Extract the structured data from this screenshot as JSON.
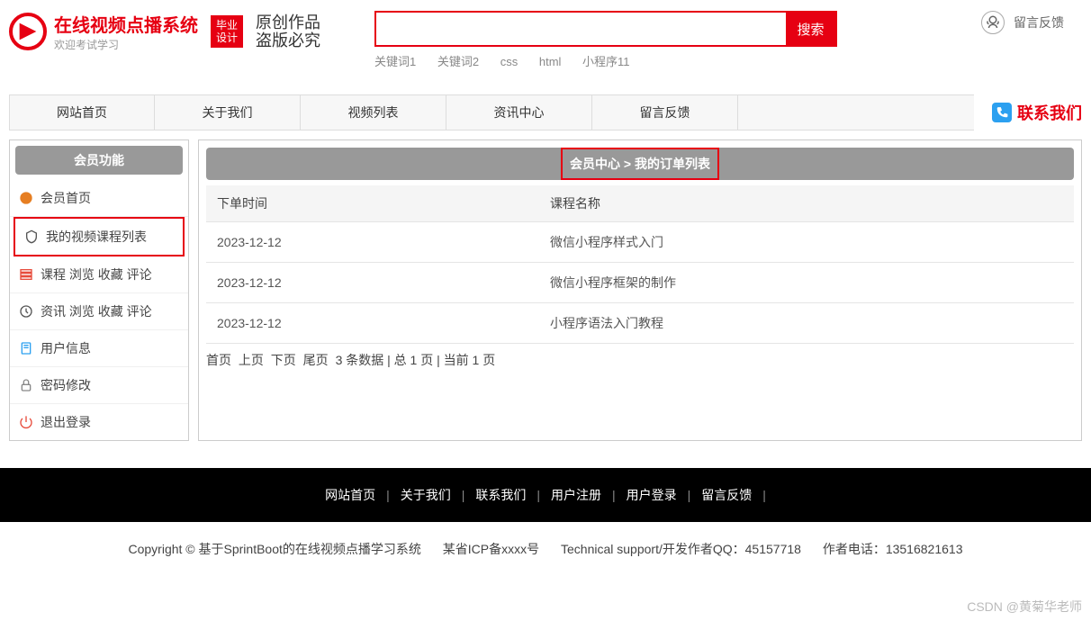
{
  "header": {
    "title": "在线视频点播系统",
    "subtitle": "欢迎考试学习",
    "badge_line1": "毕业",
    "badge_line2": "设计",
    "brush_line1": "原创作品",
    "brush_line2": "盗版必究",
    "search_btn": "搜索",
    "keywords": [
      "关键词1",
      "关键词2",
      "css",
      "html",
      "小程序11"
    ],
    "feedback": "留言反馈"
  },
  "nav": {
    "items": [
      "网站首页",
      "关于我们",
      "视频列表",
      "资讯中心",
      "留言反馈"
    ],
    "contact": "联系我们"
  },
  "sidebar": {
    "title": "会员功能",
    "items": [
      {
        "label": "会员首页",
        "icon": "home-icon",
        "color": "#e67e22"
      },
      {
        "label": "我的视频课程列表",
        "icon": "shield-icon",
        "color": "#555",
        "highlight": true
      },
      {
        "label": "课程 浏览 收藏 评论",
        "icon": "list-icon",
        "color": "#e74c3c"
      },
      {
        "label": "资讯 浏览 收藏 评论",
        "icon": "clock-icon",
        "color": "#555"
      },
      {
        "label": "用户信息",
        "icon": "user-icon",
        "color": "#2ca0f0"
      },
      {
        "label": "密码修改",
        "icon": "lock-icon",
        "color": "#888"
      },
      {
        "label": "退出登录",
        "icon": "power-icon",
        "color": "#e74c3c"
      }
    ]
  },
  "main": {
    "breadcrumb_center": "会员中心",
    "breadcrumb_sep": ">",
    "breadcrumb_page": "我的订单列表",
    "columns": [
      "下单时间",
      "课程名称"
    ],
    "rows": [
      {
        "time": "2023-12-12",
        "name": "微信小程序样式入门"
      },
      {
        "time": "2023-12-12",
        "name": "微信小程序框架的制作"
      },
      {
        "time": "2023-12-12",
        "name": "小程序语法入门教程"
      }
    ],
    "pager": {
      "first": "首页",
      "prev": "上页",
      "next": "下页",
      "last": "尾页",
      "info": "3 条数据 | 总 1 页 | 当前 1 页"
    }
  },
  "footer": {
    "links": [
      "网站首页",
      "关于我们",
      "联系我们",
      "用户注册",
      "用户登录",
      "留言反馈"
    ],
    "copyright_prefix": "Copyright © 基于SprintBoot的在线视频点播学习系统",
    "icp": "某省ICP备xxxx号",
    "tech": "Technical support/开发作者QQ：45157718",
    "phone": "作者电话：13516821613"
  },
  "watermark": "CSDN @黄菊华老师"
}
